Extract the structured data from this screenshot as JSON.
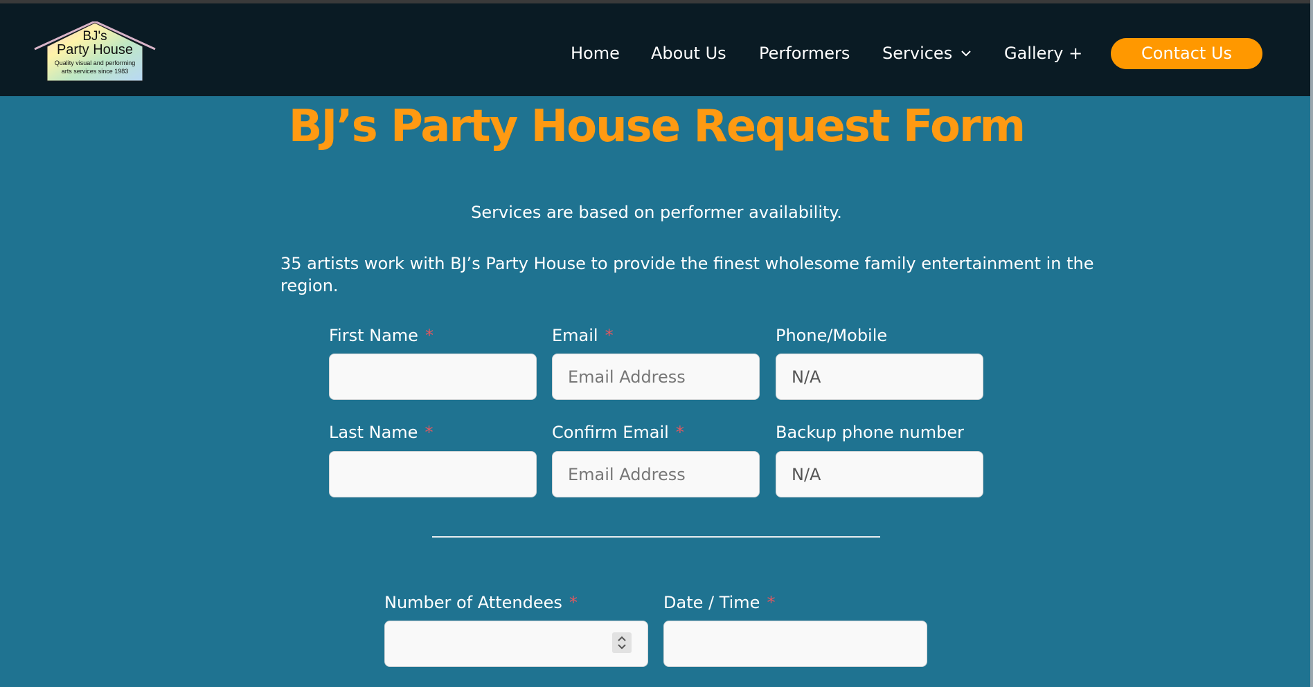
{
  "brand": {
    "logo_line1": "BJ's",
    "logo_line2": "Party House",
    "logo_tagline1": "Quality visual and performing",
    "logo_tagline2": "arts services since 1983"
  },
  "nav": {
    "home": "Home",
    "about": "About Us",
    "performers": "Performers",
    "services": "Services",
    "gallery": "Gallery +",
    "contact": "Contact Us"
  },
  "page": {
    "title": "BJ’s Party House Request Form",
    "intro1": "Services are based on performer availability.",
    "intro2": "35 artists work with BJ’s Party House to provide the finest wholesome family entertainment in the region."
  },
  "form": {
    "first_name": {
      "label": "First Name",
      "required": "*",
      "value": ""
    },
    "email": {
      "label": "Email",
      "required": "*",
      "placeholder": "Email Address"
    },
    "phone": {
      "label": "Phone/Mobile",
      "value": "N/A"
    },
    "last_name": {
      "label": "Last Name",
      "required": "*",
      "value": ""
    },
    "confirm_email": {
      "label": "Confirm Email",
      "required": "*",
      "placeholder": "Email Address"
    },
    "backup_phone": {
      "label": "Backup phone number",
      "value": "N/A"
    },
    "attendees": {
      "label": "Number of Attendees",
      "required": "*",
      "value": ""
    },
    "datetime": {
      "label": "Date / Time",
      "required": "*",
      "value": ""
    }
  },
  "colors": {
    "header_bg": "#0a1b24",
    "page_bg": "#1f7391",
    "accent": "#ff9800",
    "required": "#e4585f"
  }
}
